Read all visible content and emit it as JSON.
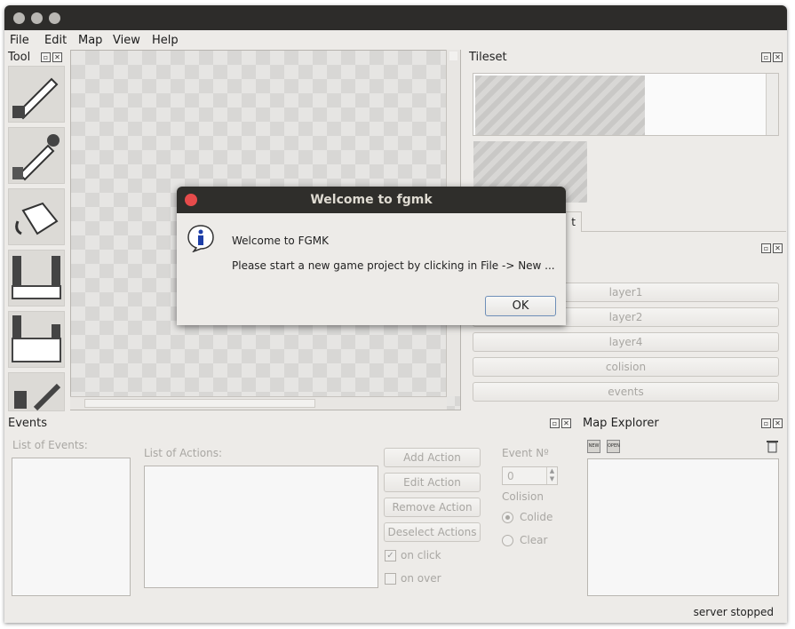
{
  "menu": [
    "File",
    "Edit",
    "Map",
    "View",
    "Help"
  ],
  "tool_panel": {
    "title": "Tool"
  },
  "tileset_panel": {
    "title": "Tileset",
    "tab_partial": "t"
  },
  "layers": [
    "layer1",
    "layer2",
    "layer4",
    "colision",
    "events"
  ],
  "events_panel": {
    "title": "Events",
    "list_events_label": "List of Events:",
    "list_actions_label": "List of Actions:",
    "buttons": [
      "Add Action",
      "Edit Action",
      "Remove Action",
      "Deselect Actions"
    ],
    "event_no_label": "Event Nº",
    "event_no_value": "0",
    "colision_label": "Colision",
    "radio_collide": "Colide",
    "radio_clear": "Clear",
    "check_on_click": "on click",
    "check_on_over": "on over"
  },
  "map_explorer": {
    "title": "Map Explorer",
    "new_label": "NEW",
    "open_label": "OPEN"
  },
  "status": "server stopped",
  "dialog": {
    "title": "Welcome to fgmk",
    "heading": "Welcome to FGMK",
    "message": "Please start a new game project by clicking in File -> New ...",
    "ok": "OK"
  },
  "colors": {
    "dialog_close": "#e64b4b",
    "titlebar": "#2d2c2a"
  }
}
